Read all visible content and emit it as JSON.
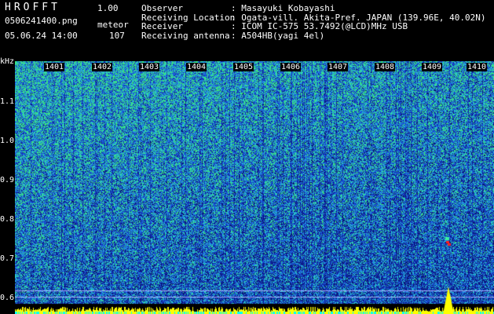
{
  "brand": "HROFFT",
  "version": "1.00",
  "filename": "0506241400.png",
  "label_meteor": "meteor",
  "datetime": "05.06.24 14:00",
  "meteor_count": "107",
  "info": [
    {
      "key": "Observer",
      "value": ": Masayuki Kobayashi"
    },
    {
      "key": "Receiving Location",
      "value": ": Ogata-vill. Akita-Pref. JAPAN (139.96E, 40.02N)"
    },
    {
      "key": "Receiver",
      "value": ": ICOM IC-575 53.7492(@LCD)MHz USB"
    },
    {
      "key": "Receiving antenna",
      "value": ": A504HB(yagi 4el)"
    }
  ],
  "y_unit": "kHz",
  "y_ticks": [
    "1.1",
    "1.0",
    "0.9",
    "0.8",
    "0.7",
    "0.6"
  ],
  "x_ticks": [
    "1401",
    "1402",
    "1403",
    "1404",
    "1405",
    "1406",
    "1407",
    "1408",
    "1409",
    "1410"
  ],
  "colors": {
    "low": "#0a1a8c",
    "mid": "#1e63d6",
    "high": "#2ee08a",
    "peak": "#ffff00",
    "meteor": "#ff2020",
    "baseline": "#00ffff"
  }
}
